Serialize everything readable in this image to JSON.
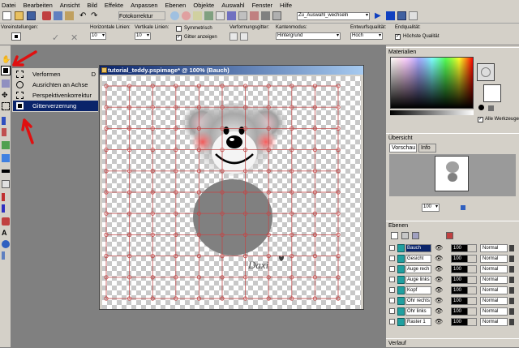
{
  "menu": [
    "Datei",
    "Bearbeiten",
    "Ansicht",
    "Bild",
    "Effekte",
    "Anpassen",
    "Ebenen",
    "Objekte",
    "Auswahl",
    "Fenster",
    "Hilfe"
  ],
  "toolbar": {
    "fotokorrektur": "Fotokorrektur",
    "script_combo": "Zu_Auswahl_wechseln"
  },
  "options": {
    "preset_label": "Voreinstellungen:",
    "h_label": "Horizontale Linien:",
    "h_value": "10",
    "v_label": "Vertikale Linien:",
    "v_value": "10",
    "symmetric": "Symmetrisch",
    "show_grid": "Gitter anzeigen",
    "deform_label": "Verformungsgitter:",
    "edge_label": "Kantenmodus:",
    "edge_value": "Hintergrund",
    "draft_label": "Entwurfsqualität:",
    "draft_value": "Hoch",
    "final_label": "Endqualität:",
    "final_value": "Höchste Qualität"
  },
  "flyout": [
    "Verformen",
    "Ausrichten an Achse",
    "Perspektivenkorrektur",
    "Gitterverzerrung"
  ],
  "canvas_window": {
    "title": "tutorial_teddy.pspimage* @ 100% (Bauch)"
  },
  "signature": "Daxi",
  "panels": {
    "materials": "Materialien",
    "all_tools": "Alle Werkzeuge",
    "overview": "Übersicht",
    "tab_preview": "Vorschau",
    "tab_info": "Info",
    "zoom": "100",
    "layers": "Ebenen",
    "history": "Verlauf"
  },
  "layers": [
    {
      "name": "Bauch",
      "opacity": "100",
      "blend": "Normal"
    },
    {
      "name": "Gesicht",
      "opacity": "100",
      "blend": "Normal"
    },
    {
      "name": "Auge rech",
      "opacity": "100",
      "blend": "Normal"
    },
    {
      "name": "Auge links",
      "opacity": "100",
      "blend": "Normal"
    },
    {
      "name": "Kopf",
      "opacity": "100",
      "blend": "Normal"
    },
    {
      "name": "Ohr rechts",
      "opacity": "100",
      "blend": "Normal"
    },
    {
      "name": "Ohr links",
      "opacity": "100",
      "blend": "Normal"
    },
    {
      "name": "Raster 1",
      "opacity": "100",
      "blend": "Normal"
    }
  ],
  "colors": {
    "titlebar": "#0a246a",
    "panel": "#d4d0c8",
    "highlight": "#0a246a",
    "arrow": "#e01010",
    "grid": "#b03030"
  }
}
